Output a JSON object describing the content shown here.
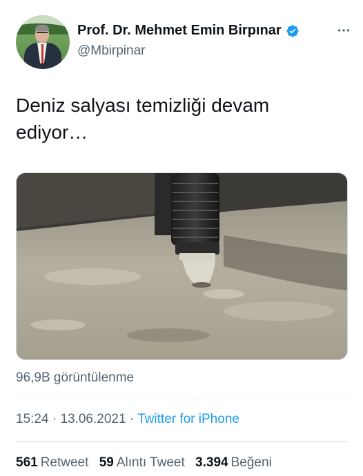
{
  "author": {
    "display_name": "Prof. Dr. Mehmet Emin Birpınar",
    "handle": "@Mbirpinar",
    "verified": true
  },
  "tweet": {
    "text": "Deniz salyası temizliği devam ediyor…",
    "views": "96,9B görüntülenme",
    "time": "15:24",
    "separator": " · ",
    "date": "13.06.2021",
    "source": "Twitter for iPhone"
  },
  "stats": {
    "retweets": "561",
    "retweets_label": "Retweet",
    "quotes": "59",
    "quotes_label": "Alıntı Tweet",
    "likes": "3.394",
    "likes_label": "Beğeni"
  },
  "colors": {
    "accent": "#1d9bf0",
    "secondary_text": "#536471"
  },
  "icons": {
    "verified": "verified-badge-icon",
    "more": "more-options-icon"
  }
}
